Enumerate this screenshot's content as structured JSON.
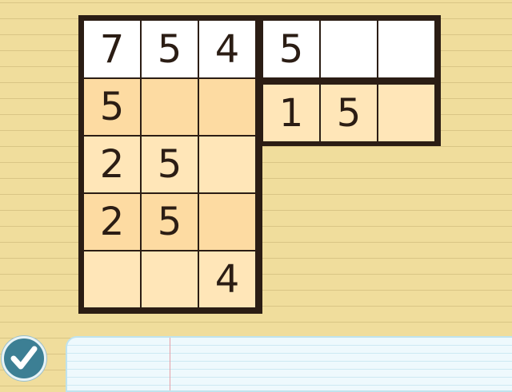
{
  "puzzle": {
    "left_grid": [
      [
        {
          "value": "7",
          "shade": "white"
        },
        {
          "value": "5",
          "shade": "white"
        },
        {
          "value": "4",
          "shade": "white"
        }
      ],
      [
        {
          "value": "5",
          "shade": "dark"
        },
        {
          "value": "",
          "shade": "dark"
        },
        {
          "value": "",
          "shade": "dark"
        }
      ],
      [
        {
          "value": "2",
          "shade": "light"
        },
        {
          "value": "5",
          "shade": "light"
        },
        {
          "value": "",
          "shade": "light"
        }
      ],
      [
        {
          "value": "2",
          "shade": "dark"
        },
        {
          "value": "5",
          "shade": "dark"
        },
        {
          "value": "",
          "shade": "dark"
        }
      ],
      [
        {
          "value": "",
          "shade": "light"
        },
        {
          "value": "",
          "shade": "light"
        },
        {
          "value": "4",
          "shade": "light"
        }
      ]
    ],
    "right_grid": [
      [
        {
          "value": "5",
          "shade": "white"
        },
        {
          "value": "",
          "shade": "white"
        },
        {
          "value": "",
          "shade": "white"
        }
      ],
      [
        {
          "value": "1",
          "shade": "light"
        },
        {
          "value": "5",
          "shade": "light"
        },
        {
          "value": "",
          "shade": "light"
        }
      ]
    ]
  },
  "controls": {
    "check_icon": "checkmark-icon"
  },
  "colors": {
    "background": "#f0dd9c",
    "grid_border": "#2b1d14",
    "cell_white": "#ffffff",
    "cell_dark": "#fddba2",
    "cell_light": "#ffe6b8",
    "check_button": "#3c7f94"
  }
}
